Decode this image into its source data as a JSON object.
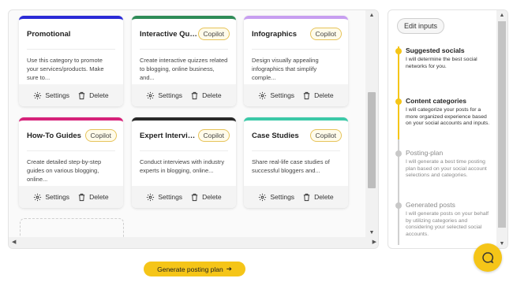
{
  "cards": [
    {
      "title": "Promotional",
      "copilot": "",
      "desc": "Use this category to promote your services/products. Make sure to...",
      "color": "#2b2bd6"
    },
    {
      "title": "Interactive Quizz...",
      "copilot": "Copilot",
      "desc": "Create interactive quizzes related to blogging, online business, and...",
      "color": "#2e8b57"
    },
    {
      "title": "Infographics",
      "copilot": "Copilot",
      "desc": "Design visually appealing infographics that simplify comple...",
      "color": "#c79ef0"
    },
    {
      "title": "How-To Guides",
      "copilot": "Copilot",
      "desc": "Create detailed step-by-step guides on various blogging, online...",
      "color": "#d6227a"
    },
    {
      "title": "Expert Interviews",
      "copilot": "Copilot",
      "desc": "Conduct interviews with industry experts in blogging, online...",
      "color": "#2a2a2a"
    },
    {
      "title": "Case Studies",
      "copilot": "Copilot",
      "desc": "Share real-life case studies of successful bloggers and...",
      "color": "#3cc9a8"
    }
  ],
  "card_actions": {
    "settings": "Settings",
    "delete": "Delete"
  },
  "sidebar": {
    "edit_inputs": "Edit inputs",
    "steps": [
      {
        "title": "Suggested socials",
        "text": "I will determine the best social networks for you.",
        "active": true
      },
      {
        "title": "Content categories",
        "text": "I will categorize your posts for a more organized experience based on your social accounts and inputs.",
        "active": true
      },
      {
        "title": "Posting-plan",
        "text": "I will generate a best time posting plan based on your social account selections and categories.",
        "active": false
      },
      {
        "title": "Generated posts",
        "text": "I will generate posts on your behalf by utilizing categories and considering your selected social accounts.",
        "active": false
      }
    ]
  },
  "generate_button": "Generate posting plan",
  "colors": {
    "accent": "#f5c518",
    "inactive": "#bdbdbd"
  }
}
